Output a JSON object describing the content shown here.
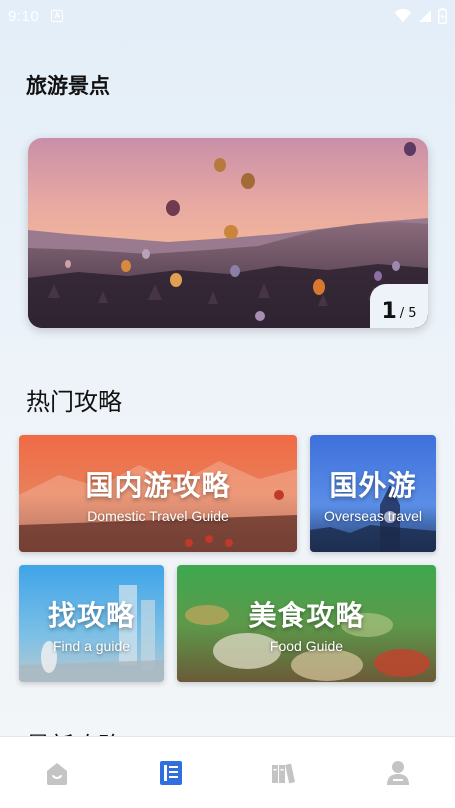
{
  "status_bar": {
    "time": "9:10",
    "notification_icon": "A",
    "icons": [
      "wifi-icon",
      "signal-icon",
      "battery-icon"
    ]
  },
  "page": {
    "title": "旅游景点"
  },
  "banner": {
    "image": "hot-air-balloons-over-canyon",
    "current_page": "1",
    "total_pages": "/ 5"
  },
  "hot_guides": {
    "title": "热门攻略",
    "cards": [
      {
        "title": "国内游攻略",
        "subtitle": "Domestic Travel Guide",
        "color": "#e8623f"
      },
      {
        "title": "国外游",
        "subtitle": "Overseas travel",
        "color": "#3e74d8"
      },
      {
        "title": "找攻略",
        "subtitle": "Find a guide",
        "color": "#4aa6d8"
      },
      {
        "title": "美食攻略",
        "subtitle": "Food Guide",
        "color": "#46a84e"
      }
    ]
  },
  "latest_guides": {
    "title": "最新攻略"
  },
  "tab_bar": {
    "tabs": [
      {
        "icon": "home-icon",
        "active": false
      },
      {
        "icon": "document-icon",
        "active": true
      },
      {
        "icon": "books-icon",
        "active": false
      },
      {
        "icon": "user-icon",
        "active": false
      }
    ],
    "active_color": "#2f6fe0",
    "inactive_color": "#c4c4c4"
  }
}
